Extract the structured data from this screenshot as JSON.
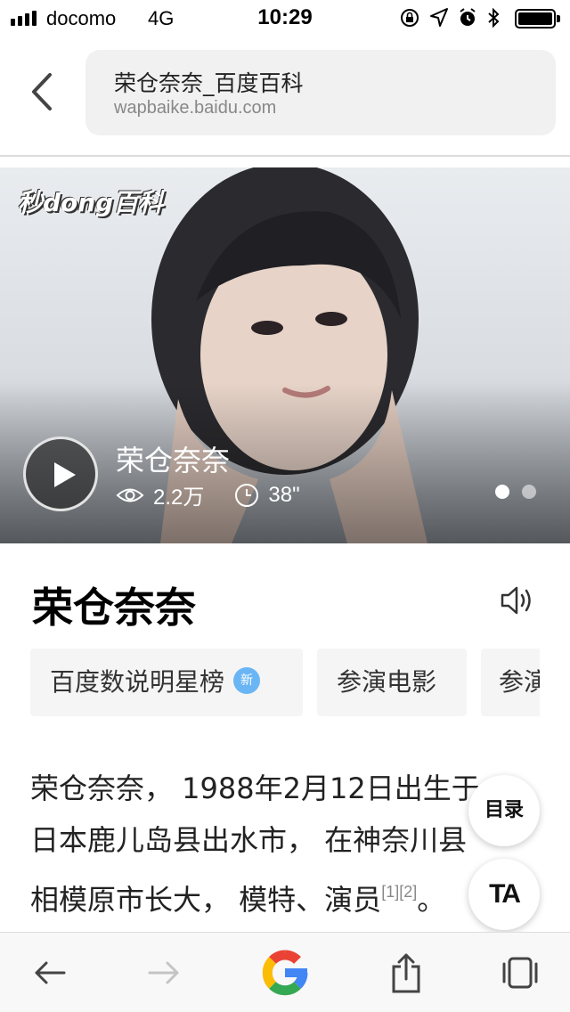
{
  "status_bar": {
    "carrier": "docomo",
    "network": "4G",
    "time": "10:29",
    "icons": [
      "orientation-lock-icon",
      "location-icon",
      "alarm-icon",
      "bluetooth-icon",
      "battery-icon"
    ]
  },
  "browser": {
    "page_title": "荣仓奈奈_百度百科",
    "domain": "wapbaike.baidu.com"
  },
  "hero": {
    "brand_logo": "秒dong百科",
    "video_title": "荣仓奈奈",
    "views": "2.2万",
    "duration": "38\"",
    "slides_total": 2,
    "active_slide": 1
  },
  "article": {
    "title": "荣仓奈奈",
    "chips": [
      {
        "label": "百度数说明星榜",
        "badge": "新"
      },
      {
        "label": "参演电影"
      },
      {
        "label": "参演"
      }
    ],
    "intro_lines": [
      "荣仓奈奈， 1988年2月12日出生于",
      "日本鹿儿岛县出水市， 在神奈川县",
      "相模原市长大， 模特、演员"
    ],
    "refs": "[1][2]",
    "intro_tail": "。"
  },
  "fabs": {
    "toc": "目录",
    "font": "TA"
  },
  "colors": {
    "accent_blue": "#6ab6f5",
    "chip_bg": "#f5f5f5",
    "url_bg": "#f1f1f1"
  }
}
